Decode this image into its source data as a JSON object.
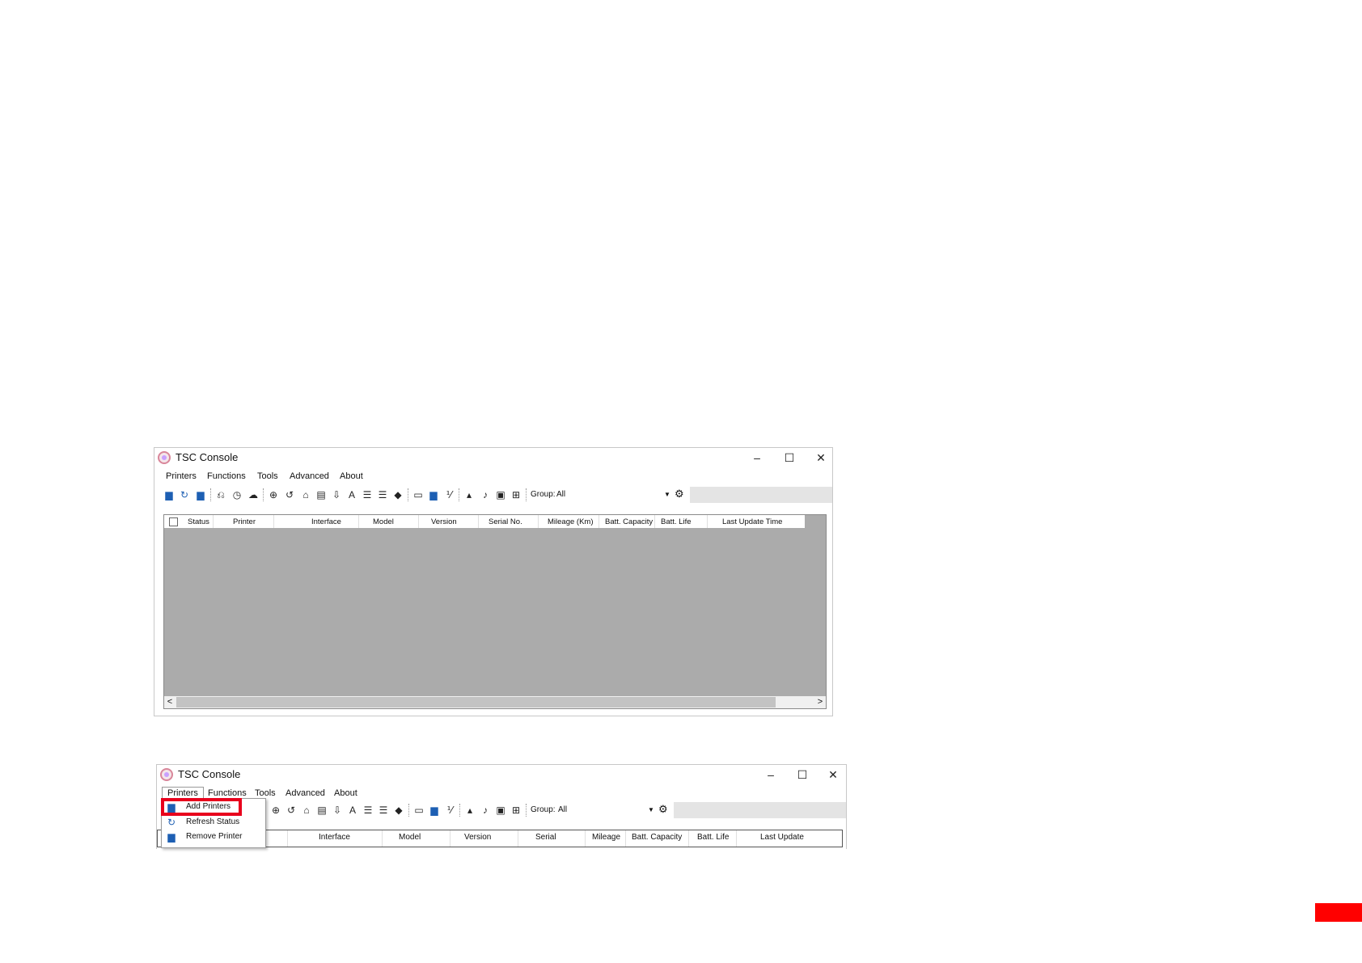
{
  "window1": {
    "title": "TSC Console",
    "controls": {
      "minimize": "–",
      "maximize": "☐",
      "close": "✕"
    },
    "menu": [
      "Printers",
      "Functions",
      "Tools",
      "Advanced",
      "About"
    ],
    "group_label": "Group:",
    "group_value": "All",
    "columns": [
      "Status",
      "Printer",
      "Interface",
      "Model",
      "Version",
      "Serial No.",
      "Mileage (Km)",
      "Batt. Capacity",
      "Batt. Life",
      "Last Update Time"
    ],
    "scroll_left": "<",
    "scroll_right": ">"
  },
  "window2": {
    "title": "TSC Console",
    "controls": {
      "minimize": "–",
      "maximize": "☐",
      "close": "✕"
    },
    "menu": [
      "Printers",
      "Functions",
      "Tools",
      "Advanced",
      "About"
    ],
    "group_label": "Group:",
    "group_value": "All",
    "columns": [
      "Interface",
      "Model",
      "Version",
      "Serial",
      "Mileage",
      "Batt. Capacity",
      "Batt. Life",
      "Last Update"
    ],
    "printers_menu": [
      {
        "label": "Add Printers",
        "icon": "add-printer-icon"
      },
      {
        "label": "Refresh Status",
        "icon": "refresh-icon"
      },
      {
        "label": "Remove Printer",
        "icon": "remove-printer-icon"
      }
    ]
  },
  "colors": {
    "highlight": "#e8001c",
    "grid_bg": "#ababab",
    "accent_tab": "#ff0000"
  }
}
